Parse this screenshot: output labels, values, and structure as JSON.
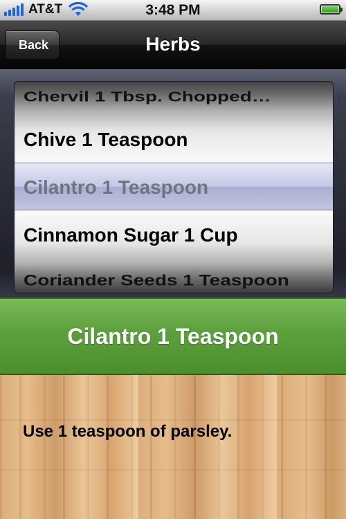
{
  "status_bar": {
    "carrier": "AT&T",
    "time": "3:48 PM",
    "signal_icon": "signal-bars-icon",
    "wifi_icon": "wifi-icon",
    "battery_icon": "battery-icon",
    "battery_level": 1.0
  },
  "nav": {
    "title": "Herbs",
    "back_label": "Back"
  },
  "picker": {
    "items": [
      "Chervil 1 Tbsp. Chopped…",
      "Chive 1 Teaspoon",
      "Cilantro 1 Teaspoon",
      "Cinnamon Sugar 1 Cup",
      "Coriander Seeds 1 Teaspoon"
    ],
    "selected_index": 2
  },
  "selected": {
    "label": "Cilantro 1 Teaspoon"
  },
  "tip": {
    "text": "Use 1 teaspoon of parsley."
  },
  "colors": {
    "banner_green": "#5ea23e",
    "nav_black": "#1a1a1a",
    "signal_blue": "#1e64d6"
  }
}
